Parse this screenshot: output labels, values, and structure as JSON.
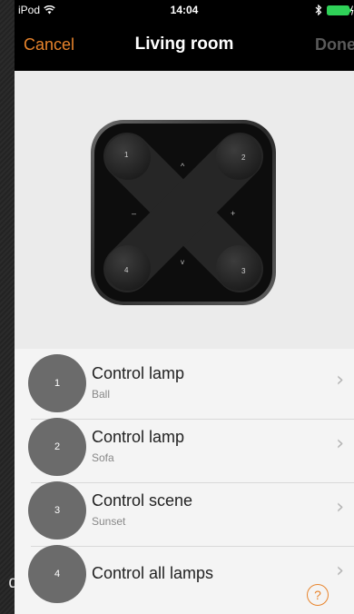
{
  "background_fragment": "d",
  "status_bar": {
    "carrier": "iPod",
    "time": "14:04"
  },
  "nav": {
    "cancel_label": "Cancel",
    "title": "Living room",
    "done_label": "Done"
  },
  "remote": {
    "button_labels": {
      "b1": "1",
      "b2": "2",
      "b3": "3",
      "b4": "4"
    },
    "arrow_labels": {
      "up": "^",
      "down": "v",
      "minus": "–",
      "plus": "+"
    }
  },
  "list": {
    "rows": [
      {
        "number": "1",
        "title": "Control lamp",
        "subtitle": "Ball"
      },
      {
        "number": "2",
        "title": "Control lamp",
        "subtitle": "Sofa"
      },
      {
        "number": "3",
        "title": "Control scene",
        "subtitle": "Sunset"
      },
      {
        "number": "4",
        "title": "Control all lamps",
        "subtitle": ""
      }
    ],
    "chevron": "›"
  },
  "help": {
    "label": "?"
  },
  "colors": {
    "accent": "#e8842c",
    "nav_bg": "#000000",
    "circle": "#6b6b6b",
    "battery": "#2fd158"
  }
}
